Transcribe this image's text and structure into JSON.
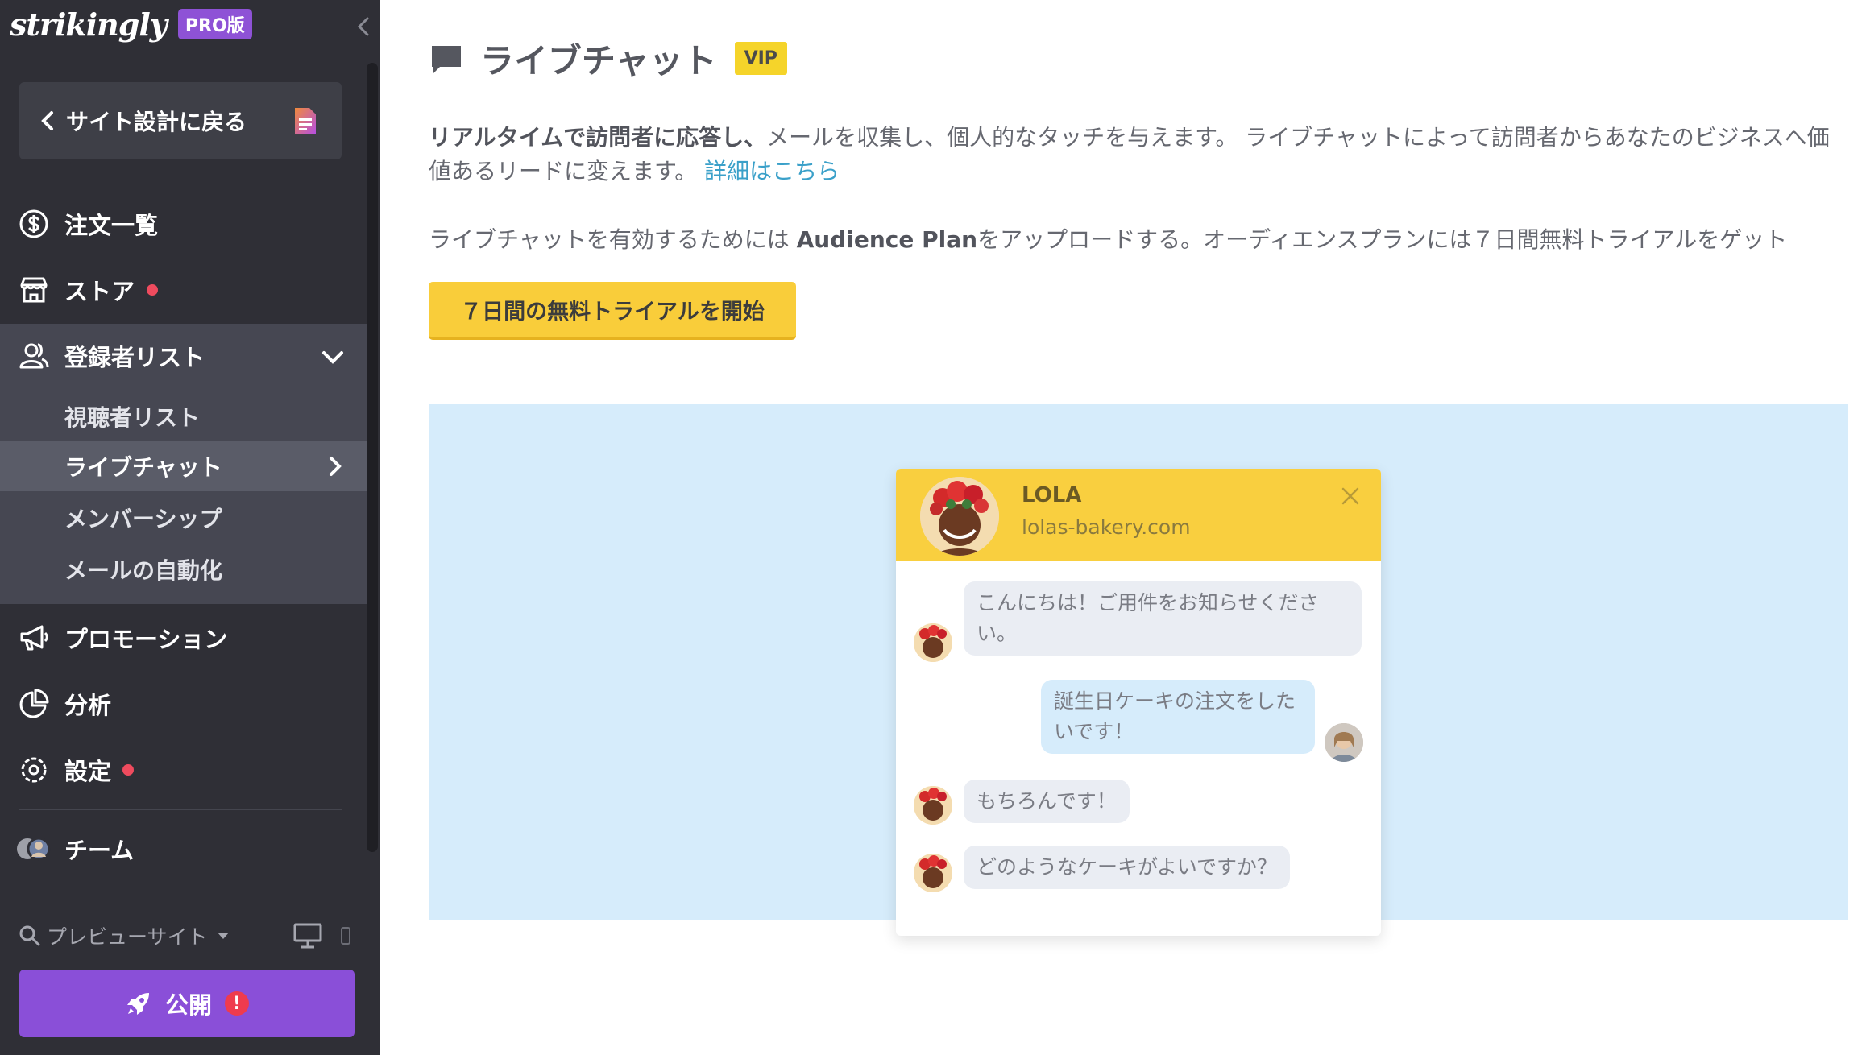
{
  "sidebar": {
    "brand": "strikingly",
    "pro_badge": "PRO版",
    "back_button": "サイト設計に戻る",
    "nav": {
      "orders": "注文一覧",
      "store": "ストア",
      "subscribers": "登録者リスト",
      "promotion": "プロモーション",
      "analytics": "分析",
      "settings": "設定",
      "team": "チーム"
    },
    "sub_items": {
      "audience": "視聴者リスト",
      "livechat": "ライブチャット",
      "membership": "メンバーシップ",
      "email_automation": "メールの自動化"
    },
    "preview_site": "プレビューサイト",
    "publish": "公開",
    "publish_warning": "!"
  },
  "main": {
    "title": "ライブチャット",
    "vip_badge": "VIP",
    "desc_bold": "リアルタイムで訪問者に応答し、",
    "desc_rest": "メールを収集し、個人的なタッチを与えます。 ライブチャットによって訪問者からあなたのビジネスへ価値あるリードに変えます。 ",
    "desc_link": "詳細はこちら",
    "plan_prefix": "ライブチャットを有効するためには ",
    "plan_bold": "Audience Plan",
    "plan_suffix": "をアップロードする。オーディエンスプランには７日間無料トライアルをゲット",
    "trial_button": "７日間の無料トライアルを開始"
  },
  "chat_preview": {
    "name": "LOLA",
    "site": "lolas-bakery.com",
    "messages": [
      {
        "from": "bot",
        "text": "こんにちは！ご用件をお知らせください。"
      },
      {
        "from": "user",
        "text": "誕生日ケーキの注文をしたいです！"
      },
      {
        "from": "bot",
        "text": "もちろんです！"
      },
      {
        "from": "bot",
        "text": "どのようなケーキがよいですか？"
      }
    ]
  },
  "colors": {
    "sidebar_bg": "#2f2f36",
    "accent_purple": "#8a4fd8",
    "accent_yellow": "#f9cd3a",
    "alert_red": "#ef4b5e",
    "preview_bg": "#d6ecfb"
  }
}
